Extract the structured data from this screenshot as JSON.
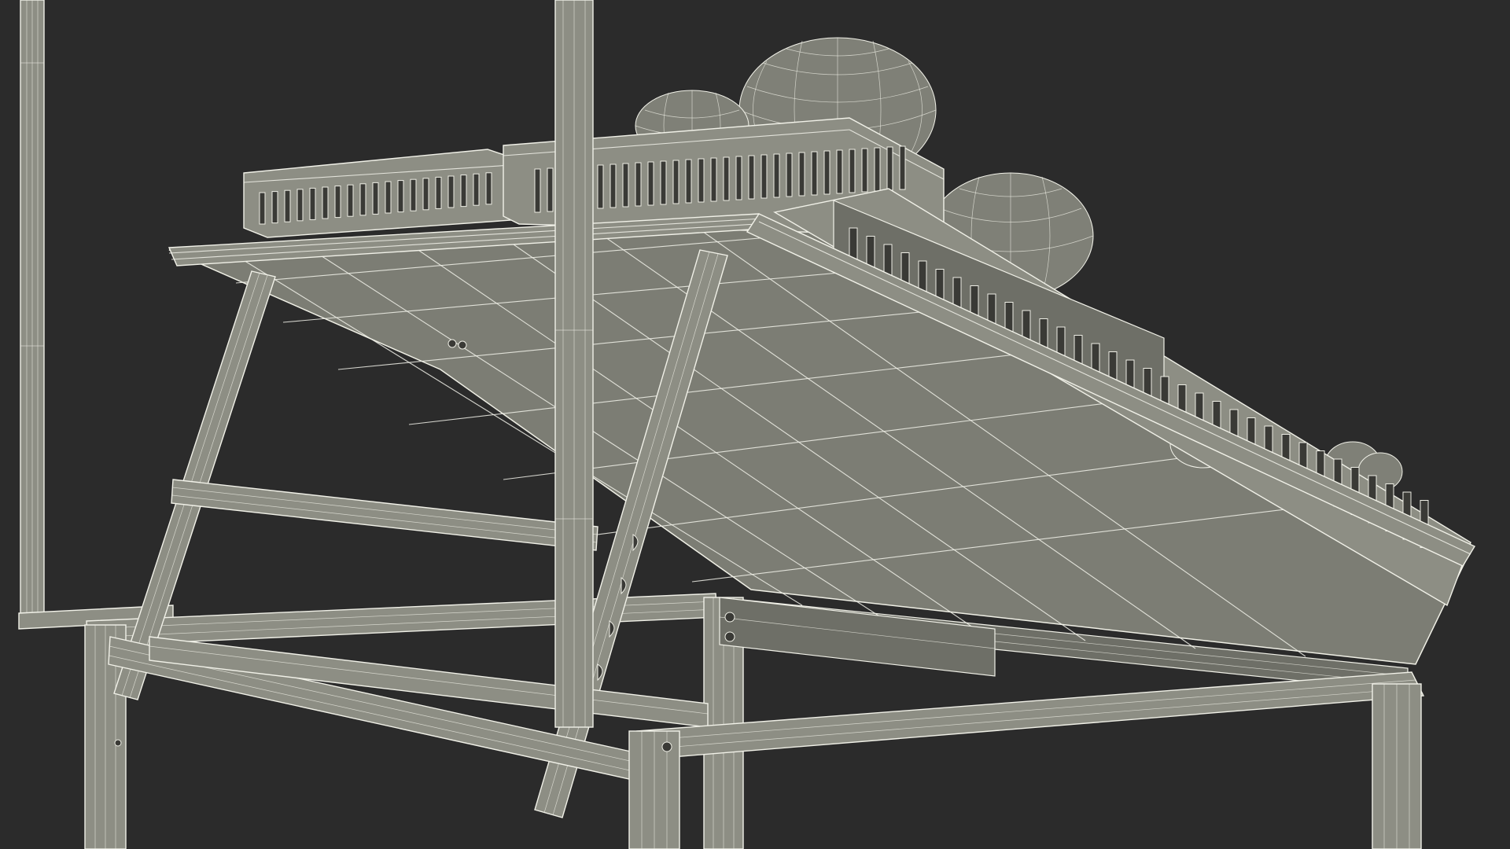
{
  "scene": {
    "subject": "",
    "render_style": "wireframe-on-shaded",
    "background_color": "#2b2b2b",
    "mesh_color": "#8d8e84",
    "wire_color": "#f2f2ea"
  }
}
